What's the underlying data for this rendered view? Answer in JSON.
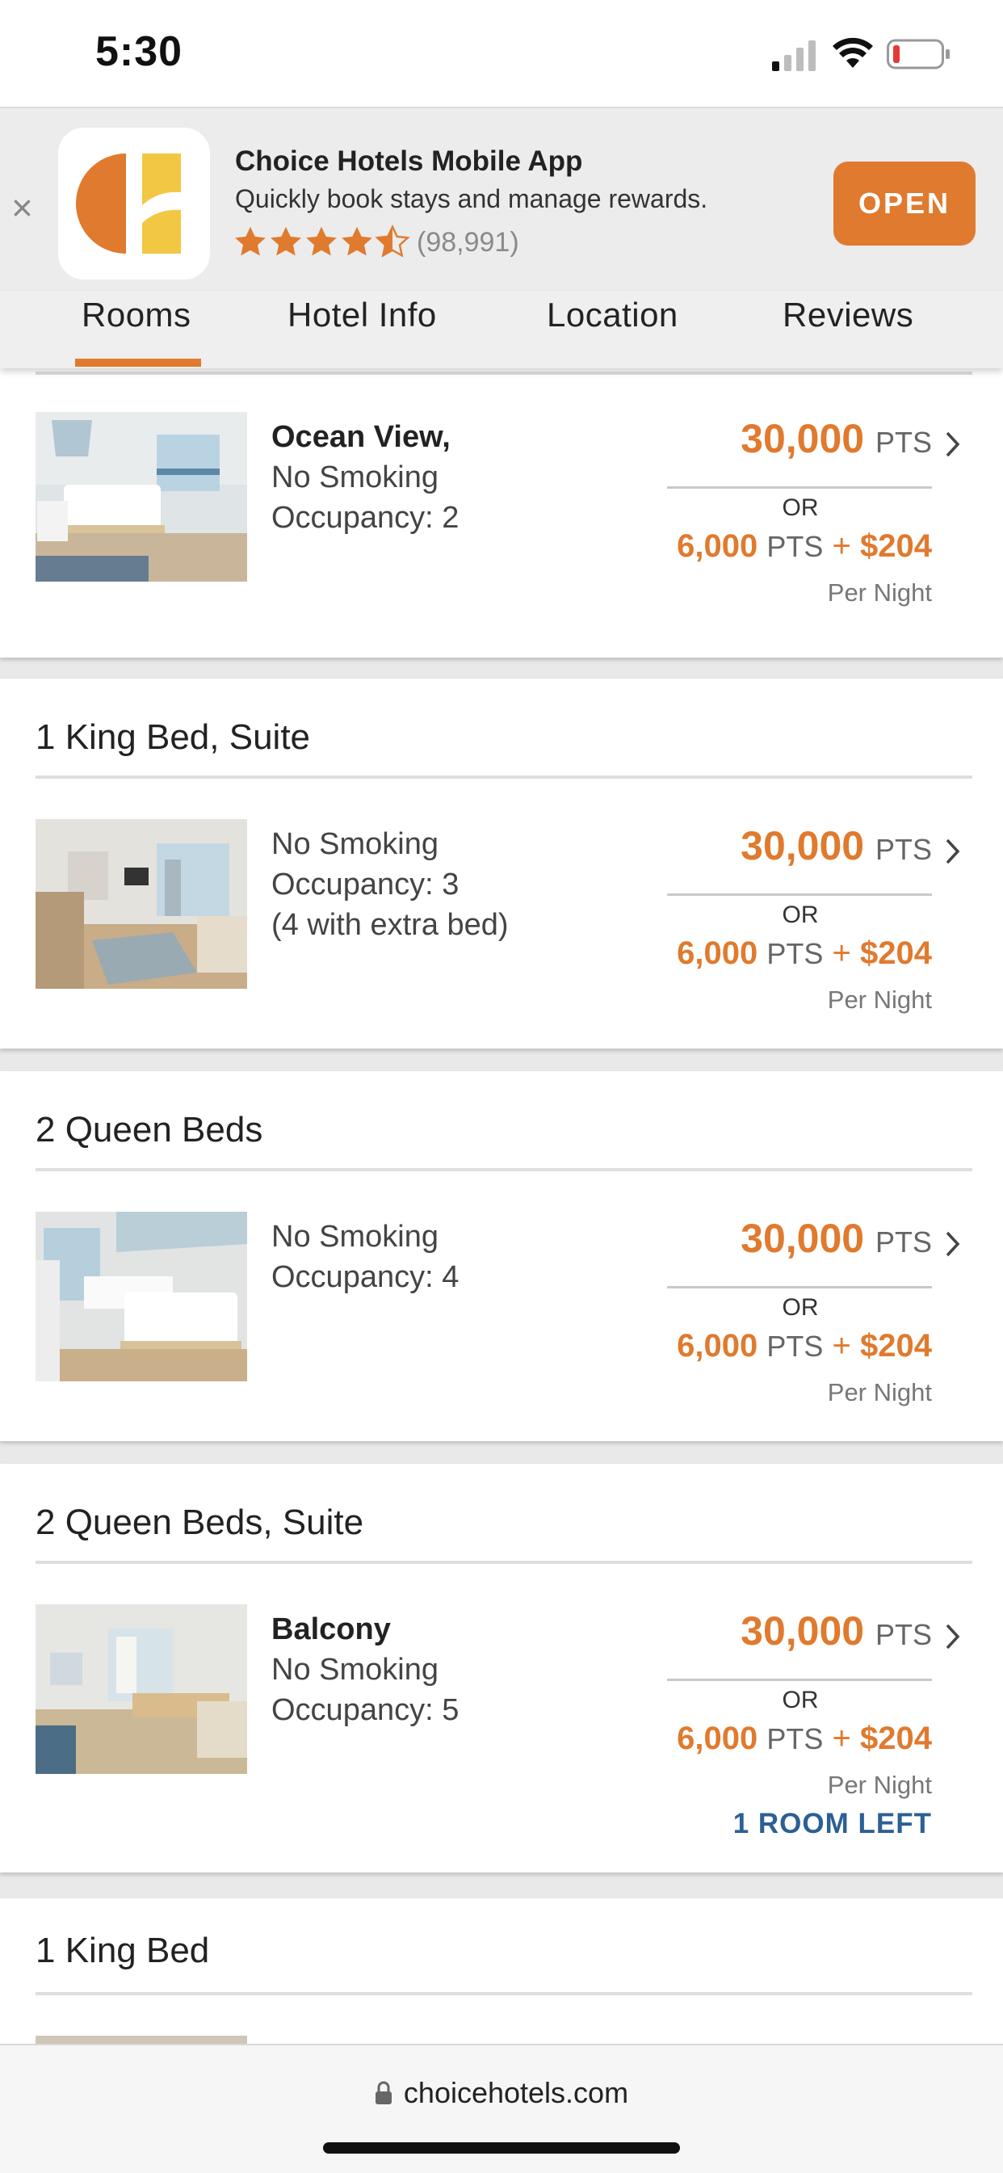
{
  "status_bar": {
    "time": "5:30"
  },
  "app_banner": {
    "close": "×",
    "app_name": "Choice Hotels Mobile App",
    "description": "Quickly book stays and manage rewards.",
    "rating": 4.5,
    "rating_count": "(98,991)",
    "open_label": "OPEN",
    "accent_color": "#e07a2e"
  },
  "tabs": [
    {
      "label": "Rooms",
      "active": true
    },
    {
      "label": "Hotel Info",
      "active": false
    },
    {
      "label": "Location",
      "active": false
    },
    {
      "label": "Reviews",
      "active": false
    }
  ],
  "rooms": [
    {
      "title": "",
      "features": [
        "Ocean View,",
        "No Smoking",
        "Occupancy: 2"
      ],
      "points": "30,000",
      "points_unit": "PTS",
      "or_label": "OR",
      "combo_points": "6,000",
      "combo_unit": "PTS",
      "combo_plus": "+",
      "combo_cash": "$204",
      "per_night": "Per Night"
    },
    {
      "title": "1 King Bed, Suite",
      "features": [
        "No Smoking",
        "Occupancy: 3",
        "(4 with extra bed)"
      ],
      "points": "30,000",
      "points_unit": "PTS",
      "or_label": "OR",
      "combo_points": "6,000",
      "combo_unit": "PTS",
      "combo_plus": "+",
      "combo_cash": "$204",
      "per_night": "Per Night"
    },
    {
      "title": "2 Queen Beds",
      "features": [
        "No Smoking",
        "Occupancy: 4"
      ],
      "points": "30,000",
      "points_unit": "PTS",
      "or_label": "OR",
      "combo_points": "6,000",
      "combo_unit": "PTS",
      "combo_plus": "+",
      "combo_cash": "$204",
      "per_night": "Per Night"
    },
    {
      "title": "2 Queen Beds, Suite",
      "features": [
        "Balcony",
        "No Smoking",
        "Occupancy: 5"
      ],
      "points": "30,000",
      "points_unit": "PTS",
      "or_label": "OR",
      "combo_points": "6,000",
      "combo_unit": "PTS",
      "combo_plus": "+",
      "combo_cash": "$204",
      "per_night": "Per Night",
      "availability": "1 ROOM LEFT"
    },
    {
      "title": "1 King Bed"
    }
  ],
  "browser": {
    "url": "choicehotels.com"
  },
  "colors": {
    "accent": "#e07a2e",
    "link_blue": "#2c5f95"
  }
}
